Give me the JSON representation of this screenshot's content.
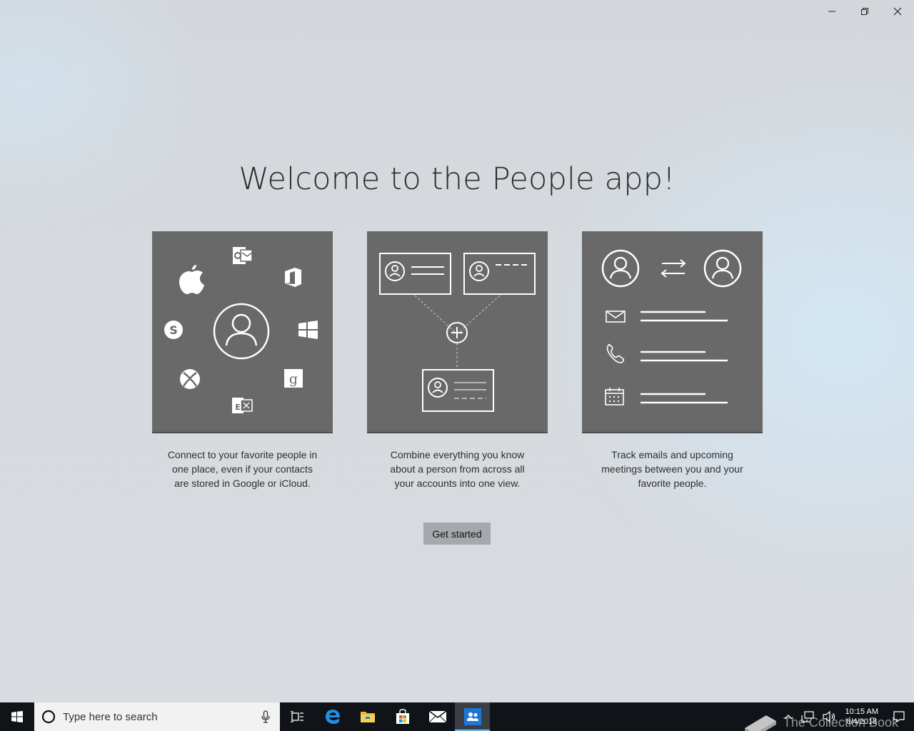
{
  "window": {
    "caption": {
      "minimize_icon": "minimize-icon",
      "restore_icon": "restore-icon",
      "close_icon": "close-icon"
    }
  },
  "welcome": {
    "title": "Welcome to the People app!",
    "cards": [
      {
        "desc_lines": [
          "Connect to your favorite people in",
          "one place, even if your contacts",
          "are stored in Google or iCloud."
        ]
      },
      {
        "desc_lines": [
          "Combine everything you know",
          "about a person from across all",
          "your accounts into one view."
        ]
      },
      {
        "desc_lines": [
          "Track emails and upcoming",
          "meetings between you and your",
          "favorite people."
        ]
      }
    ],
    "button_label": "Get started"
  },
  "taskbar": {
    "search_placeholder": "Type here to search",
    "pinned": [
      "task-view-icon",
      "edge-icon",
      "file-explorer-icon",
      "store-icon",
      "mail-icon",
      "people-icon"
    ],
    "active_app": "people-icon",
    "clock_time": "10:15 AM",
    "clock_date": "8/4/2018"
  },
  "watermark": {
    "text": "The Collection Book"
  },
  "colors": {
    "card_bg": "#696969",
    "button_bg": "#a4a9ae",
    "taskbar_bg": "#101418",
    "accent": "#76b9ed"
  }
}
